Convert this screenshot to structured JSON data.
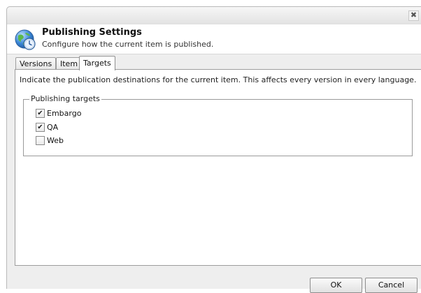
{
  "dialog": {
    "close_glyph": "✖",
    "title": "Publishing Settings",
    "subtitle": "Configure how the current item is published.",
    "icon": "globe-clock-icon"
  },
  "tabs": [
    {
      "label": "Versions",
      "active": false
    },
    {
      "label": "Item",
      "active": false
    },
    {
      "label": "Targets",
      "active": true
    }
  ],
  "targets": {
    "description": "Indicate the publication destinations for the current item. This affects every version in every language.",
    "group_label": "Publishing targets",
    "items": [
      {
        "label": "Embargo",
        "checked": true
      },
      {
        "label": "QA",
        "checked": true
      },
      {
        "label": "Web",
        "checked": false
      }
    ]
  },
  "buttons": {
    "ok": "OK",
    "cancel": "Cancel"
  }
}
